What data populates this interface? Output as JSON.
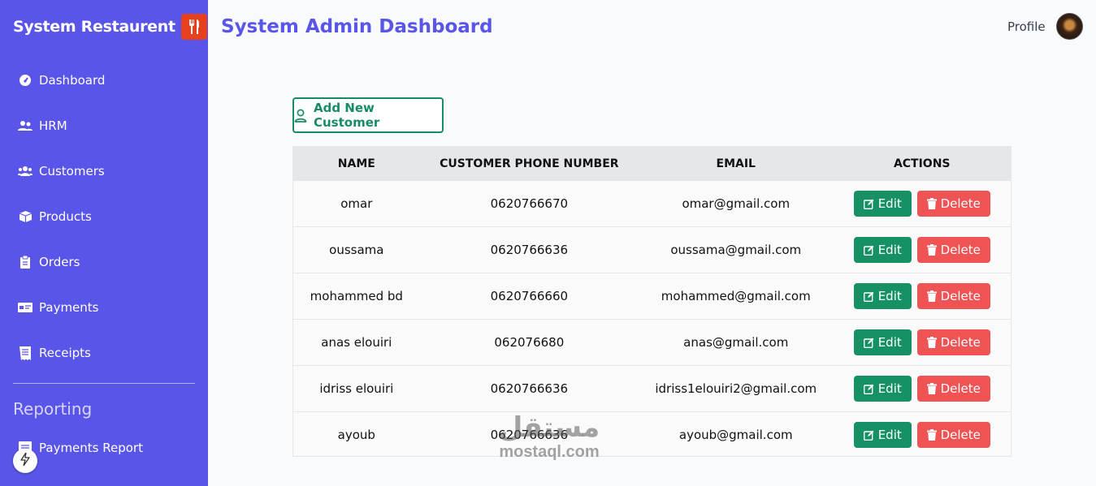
{
  "sidebar": {
    "brand": "System Restaurent",
    "items": [
      {
        "label": "Dashboard",
        "icon": "gauge-icon"
      },
      {
        "label": "HRM",
        "icon": "users-icon"
      },
      {
        "label": "Customers",
        "icon": "user-group-icon"
      },
      {
        "label": "Products",
        "icon": "box-icon"
      },
      {
        "label": "Orders",
        "icon": "clipboard-icon"
      },
      {
        "label": "Payments",
        "icon": "money-bill-icon"
      },
      {
        "label": "Receipts",
        "icon": "receipt-icon"
      }
    ],
    "section_title": "Reporting",
    "report_items": [
      {
        "label": "Payments Report",
        "icon": "report-icon"
      }
    ]
  },
  "header": {
    "title": "System Admin Dashboard",
    "profile_label": "Profile"
  },
  "toolbar": {
    "add_label": "Add New Customer"
  },
  "table": {
    "columns": [
      "NAME",
      "CUSTOMER PHONE NUMBER",
      "EMAIL",
      "ACTIONS"
    ],
    "edit_label": "Edit",
    "delete_label": "Delete",
    "rows": [
      {
        "name": "omar",
        "phone": "0620766670",
        "email": "omar@gmail.com"
      },
      {
        "name": "oussama",
        "phone": "0620766636",
        "email": "oussama@gmail.com"
      },
      {
        "name": "mohammed bd",
        "phone": "0620766660",
        "email": "mohammed@gmail.com"
      },
      {
        "name": "anas elouiri",
        "phone": "062076680",
        "email": "anas@gmail.com"
      },
      {
        "name": "idriss elouiri",
        "phone": "0620766636",
        "email": "idriss1elouiri2@gmail.com"
      },
      {
        "name": "ayoub",
        "phone": "0620766636",
        "email": "ayoub@gmail.com"
      }
    ]
  },
  "watermark": {
    "arabic": "مستقل",
    "latin": "mostaql.com"
  },
  "colors": {
    "sidebar": "#5a55e9",
    "accent": "#5a55e9",
    "edit": "#169164",
    "delete": "#ef5354",
    "brand_logo": "#e8401c"
  }
}
